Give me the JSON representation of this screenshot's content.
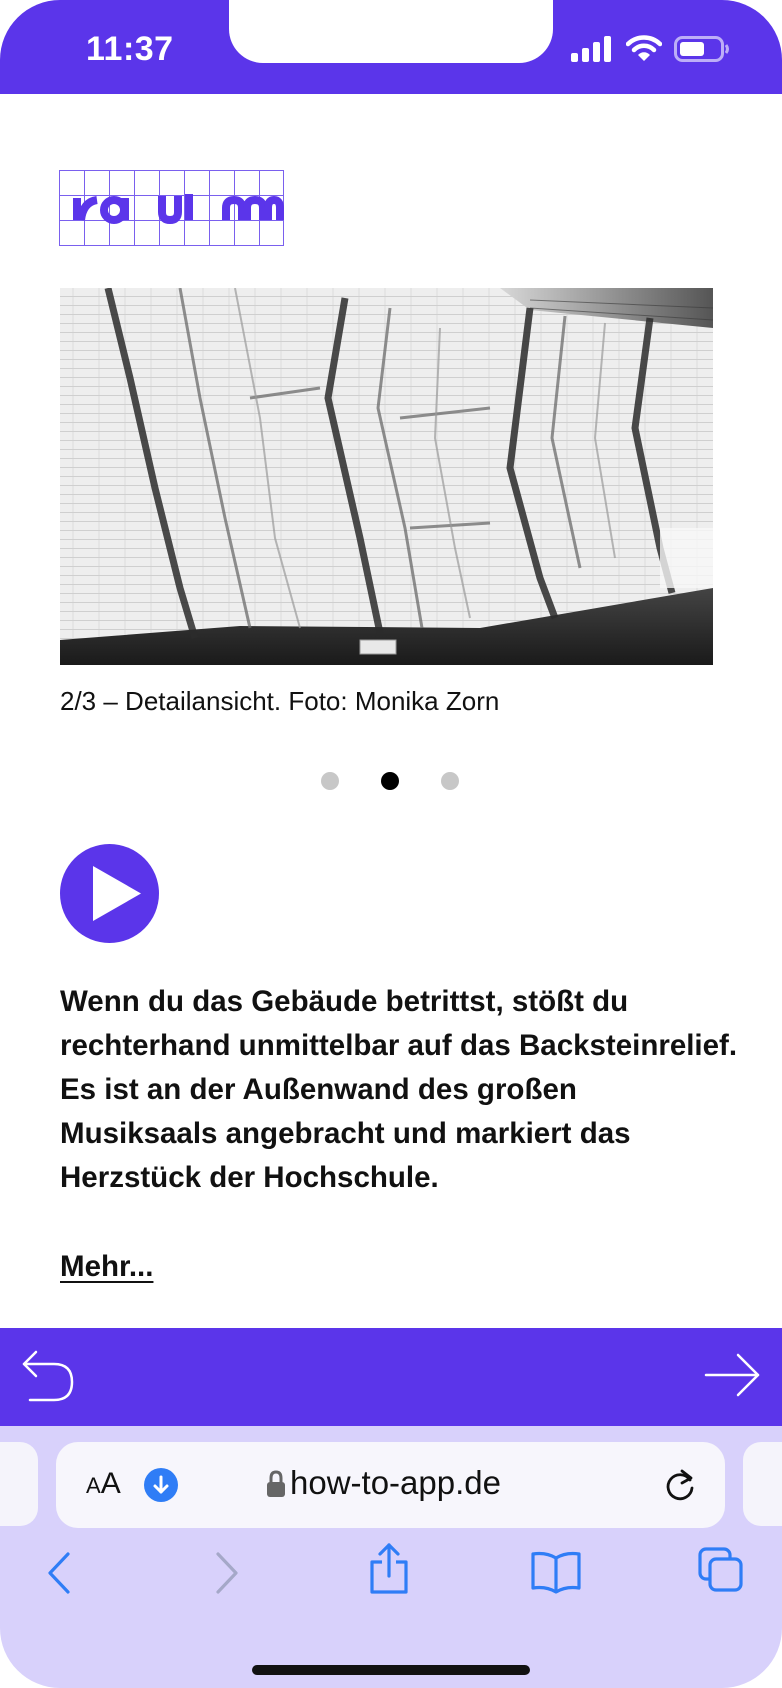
{
  "status_bar": {
    "time": "11:37"
  },
  "gallery": {
    "caption": "2/3  –  Detailansicht. Foto: Monika Zorn",
    "slide_count": 3,
    "active_slide_index": 1
  },
  "content": {
    "paragraph": "Wenn du das Gebäude betrittst, stößt du rechterhand unmittelbar auf das Backsteinrelief. Es ist an der Außenwand des großen Musiksaals angebracht und markiert das Herzstück der Hochschule.",
    "more_link": "Mehr..."
  },
  "browser": {
    "text_size_label": "AA",
    "url": "how-to-app.de"
  },
  "colors": {
    "accent": "#5b35ea",
    "safari_bar": "#d8d1fb",
    "toolbar_icon": "#2f7df6"
  },
  "icons": {
    "status": [
      "signal-icon",
      "wifi-icon",
      "battery-icon"
    ],
    "app_nav": [
      "undo-back-icon",
      "arrow-right-icon"
    ],
    "toolbar": [
      "chevron-left-icon",
      "chevron-right-icon",
      "share-icon",
      "bookmarks-icon",
      "tabs-icon"
    ]
  }
}
